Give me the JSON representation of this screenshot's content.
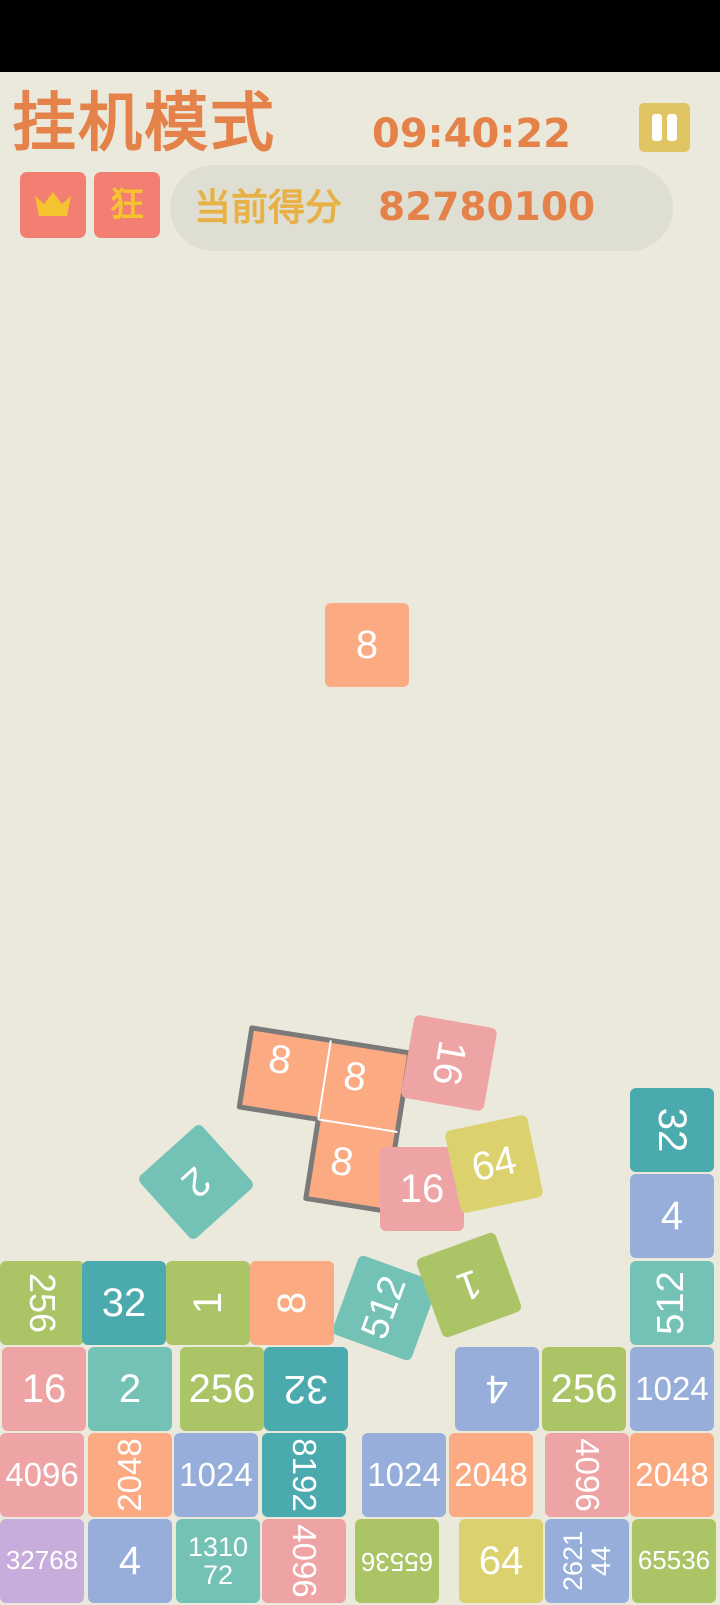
{
  "header": {
    "title": "挂机模式",
    "clock": "09:40:22",
    "badge_mad": "狂",
    "score_label": "当前得分",
    "score_value": "82780100"
  },
  "colors": {
    "accent": "#e5824a",
    "background": "#eae9dc",
    "pause": "#e1c564",
    "badge": "#f27f72"
  },
  "icons": [
    "crown-icon",
    "pause-icon"
  ],
  "board": {
    "falling_tile": "8",
    "l_piece": [
      "8",
      "8",
      "8"
    ],
    "loose_tiles": [
      "16",
      "16",
      "64",
      "2",
      "512",
      "1"
    ],
    "column_right_top": [
      "32",
      "4"
    ],
    "rows": [
      [
        "256",
        "32",
        "1",
        "8",
        "512"
      ],
      [
        "16",
        "2",
        "256",
        "32",
        "4",
        "256",
        "1024"
      ],
      [
        "4096",
        "2048",
        "1024",
        "8192",
        "1024",
        "2048",
        "4096",
        "2048"
      ],
      [
        "32768",
        "4",
        "131072",
        "4096",
        "65536",
        "64",
        "262144",
        "65536"
      ]
    ]
  }
}
